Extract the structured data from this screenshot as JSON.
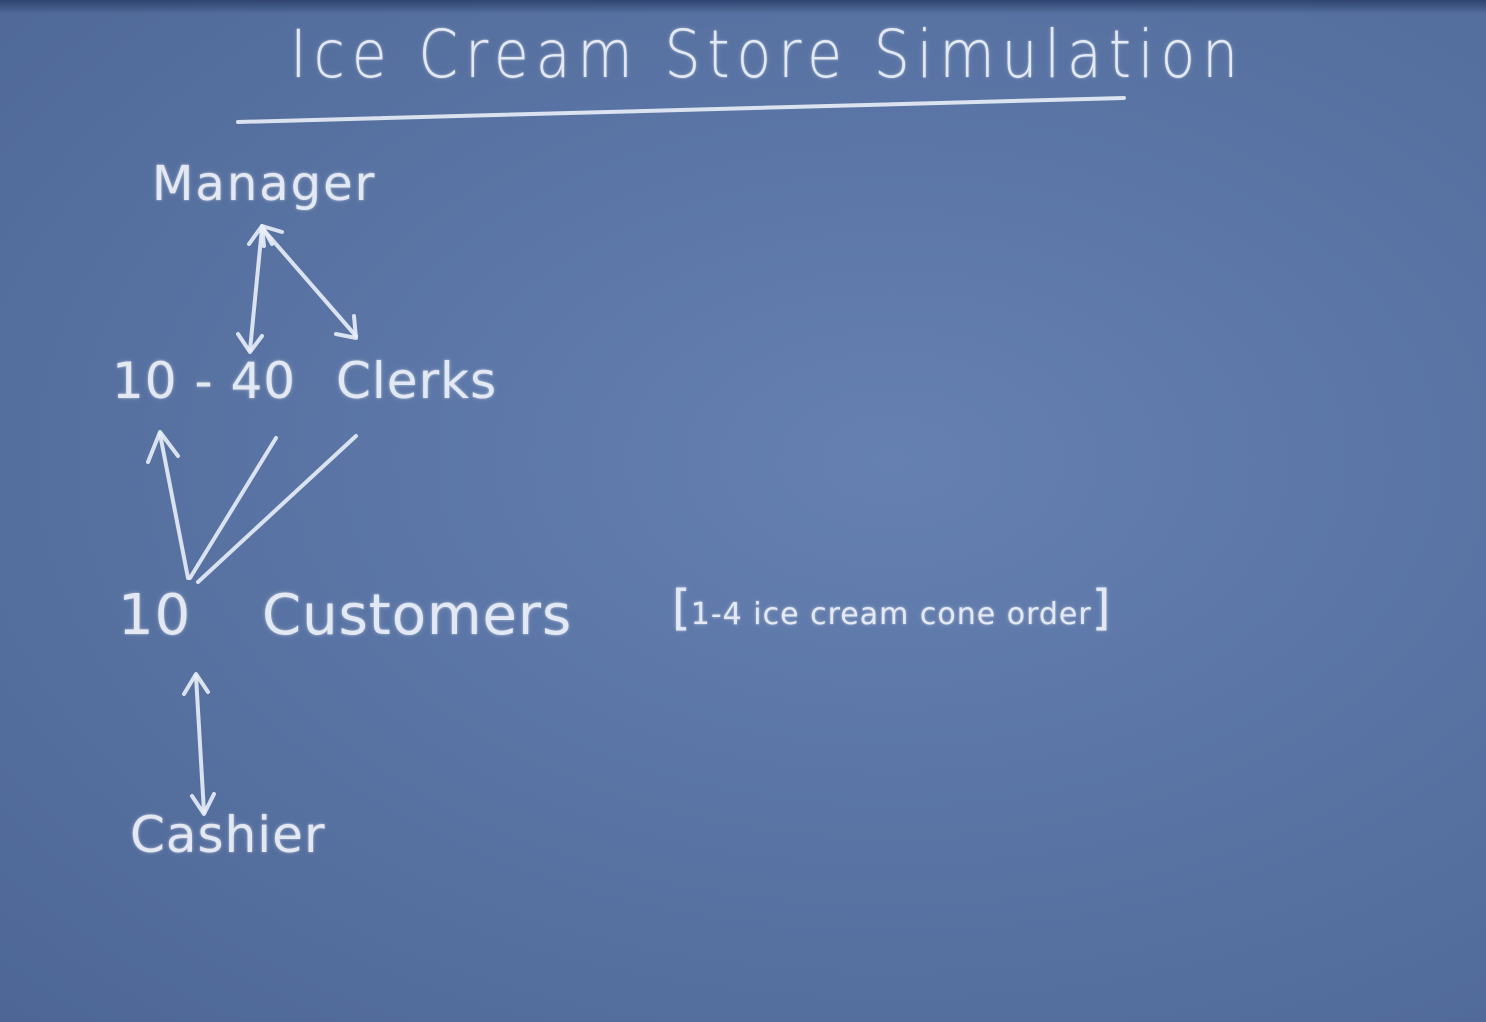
{
  "title": "Ice Cream Store Simulation",
  "nodes": {
    "manager": "Manager",
    "clerks_count": "10 - 40",
    "clerks_label": "Clerks",
    "customers_count": "10",
    "customers_label": "Customers",
    "customers_note": "1-4 ice cream cone order",
    "cashier": "Cashier"
  },
  "colors": {
    "board": "#55709e",
    "chalk": "#eef2fa"
  }
}
